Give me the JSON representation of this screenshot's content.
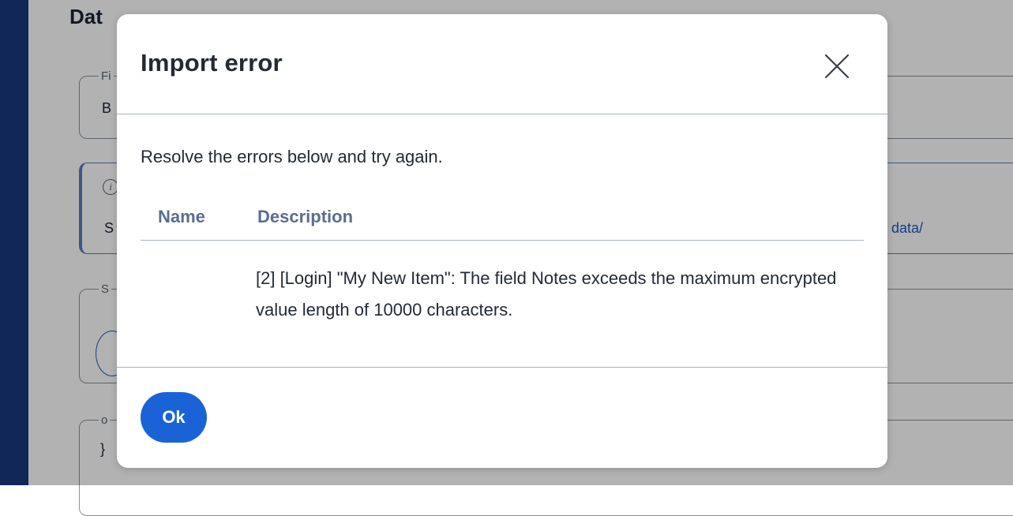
{
  "background": {
    "heading": "Dat",
    "field_legend_1": "Fi",
    "field_value_1": "B",
    "callout_text": "S",
    "callout_link": "data/",
    "field_legend_2": "S",
    "field_legend_3": "o",
    "field_value_3": "}",
    "colors": {
      "sidebar": "#17397f",
      "link": "#1a56c4"
    }
  },
  "dialog": {
    "title": "Import error",
    "close_icon": "close-icon",
    "message": "Resolve the errors below and try again.",
    "table": {
      "columns": [
        "Name",
        "Description"
      ],
      "rows": [
        {
          "name": "",
          "description": "[2] [Login] \"My New Item\": The field Notes exceeds the maximum encrypted value length of 10000 characters."
        }
      ]
    },
    "ok_label": "Ok",
    "colors": {
      "primary": "#1a63d6",
      "header_text": "#5b6d91",
      "divider": "#a7b2c7"
    }
  }
}
